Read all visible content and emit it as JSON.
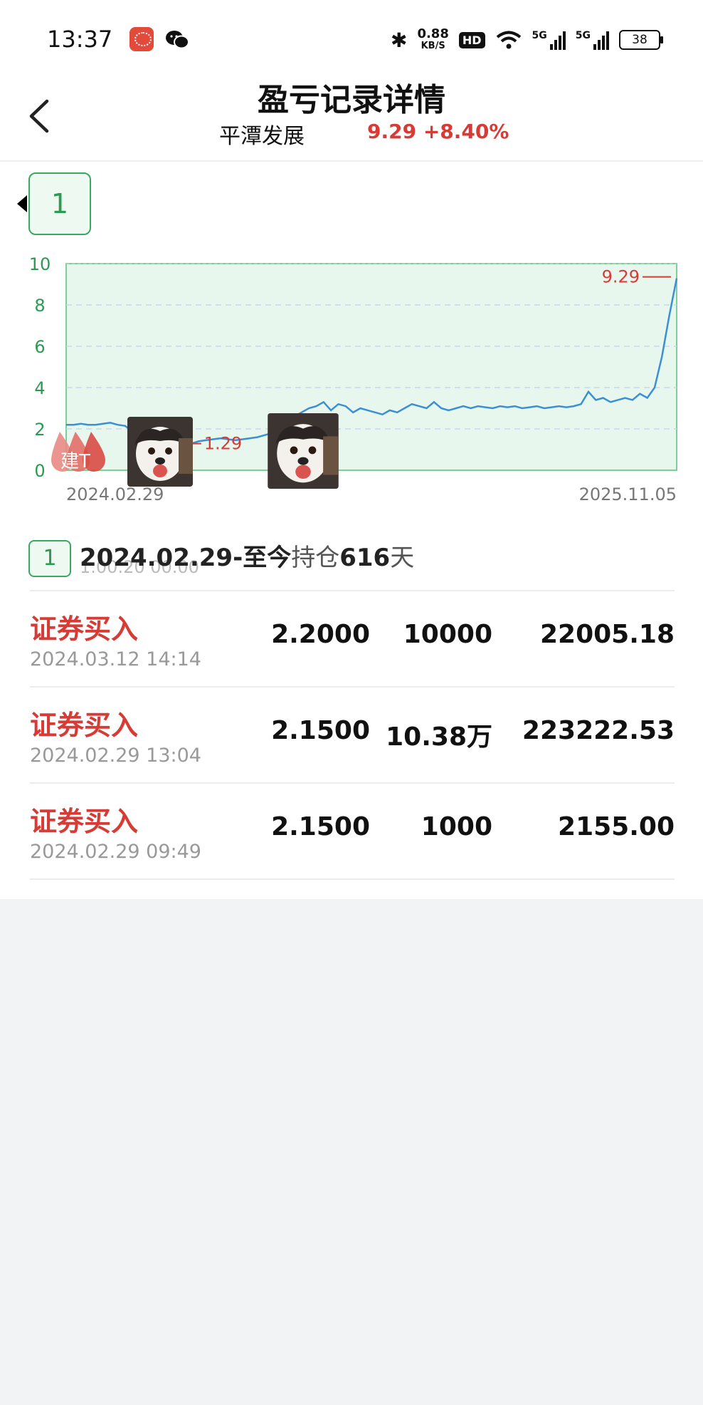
{
  "status_bar": {
    "time": "13:37",
    "speed_value": "0.88",
    "speed_unit": "KB/S",
    "hd_label": "HD",
    "net1": "5G",
    "net2": "5G",
    "battery": "38"
  },
  "header": {
    "title": "盈亏记录详情",
    "stock_name": "平潭发展",
    "quote": "9.29 +8.40%"
  },
  "position_tab": {
    "label": "1"
  },
  "chart_data": {
    "type": "line",
    "x_start": "2024.02.29",
    "x_end": "2025.11.05",
    "ylim": [
      0,
      10
    ],
    "yticks": [
      "0",
      "2",
      "4",
      "6",
      "8",
      "10"
    ],
    "low_label": "1.29",
    "high_label": "9.29",
    "series": [
      {
        "values": [
          2.2,
          2.2,
          2.25,
          2.2,
          2.2,
          2.25,
          2.3,
          2.2,
          2.15,
          1.9,
          1.95,
          1.9,
          1.85,
          1.6,
          1.5,
          1.4,
          1.3,
          1.29,
          1.4,
          1.45,
          1.5,
          1.55,
          1.5,
          1.45,
          1.5,
          1.55,
          1.6,
          1.7,
          1.8,
          2.0,
          2.3,
          2.6,
          2.8,
          3.0,
          3.1,
          3.3,
          2.9,
          3.2,
          3.1,
          2.8,
          3.0,
          2.9,
          2.8,
          2.7,
          2.9,
          2.8,
          3.0,
          3.2,
          3.1,
          3.0,
          3.3,
          3.0,
          2.9,
          3.0,
          3.1,
          3.0,
          3.1,
          3.05,
          3.0,
          3.1,
          3.05,
          3.1,
          3.0,
          3.05,
          3.1,
          3.0,
          3.05,
          3.1,
          3.05,
          3.1,
          3.2,
          3.8,
          3.4,
          3.5,
          3.3,
          3.4,
          3.5,
          3.4,
          3.7,
          3.5,
          4.0,
          5.5,
          7.5,
          9.29
        ]
      }
    ]
  },
  "summary": {
    "badge": "1",
    "period": "2024.02.29-",
    "until": "至今",
    "hold": "持仓",
    "days": "616",
    "unit": "天",
    "ghost_time": "1.00.20 00.00"
  },
  "records": [
    {
      "type": "证券买入",
      "datetime": "2024.03.12 14:14",
      "price": "2.2000",
      "qty": "10000",
      "amount": "22005.18"
    },
    {
      "type": "证券买入",
      "datetime": "2024.02.29 13:04",
      "price": "2.1500",
      "qty": "10.38万",
      "amount": "223222.53"
    },
    {
      "type": "证券买入",
      "datetime": "2024.02.29 09:49",
      "price": "2.1500",
      "qty": "1000",
      "amount": "2155.00"
    }
  ],
  "stamp_text": "建T",
  "colors": {
    "up_red": "#d63b35",
    "green": "#2b9a52",
    "chart_fill": "#e8f7ee",
    "line_blue": "#3a8fd6"
  }
}
